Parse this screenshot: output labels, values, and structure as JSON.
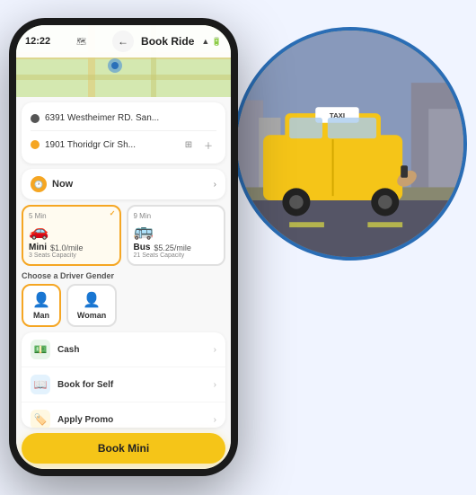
{
  "status_bar": {
    "time": "12:22",
    "signal": "▲▼",
    "wifi": "WiFi",
    "battery": "🔋"
  },
  "header": {
    "back_label": "←",
    "title": "Book Ride"
  },
  "location": {
    "origin": "6391 Westheimer RD. San...",
    "destination": "1901 Thoridgr Cir Sh..."
  },
  "time": {
    "label": "Now",
    "icon": "🕐"
  },
  "ride_options": [
    {
      "name": "Mini",
      "time": "5 Min",
      "icon": "🚗",
      "price": "$1.0/mile",
      "capacity": "3 Seats Capacity",
      "selected": true
    },
    {
      "name": "Bus",
      "time": "9 Min",
      "icon": "🚌",
      "price": "$5.25/mile",
      "capacity": "21 Seats Capacity",
      "selected": false
    }
  ],
  "gender_section": {
    "label": "Choose a Driver Gender"
  },
  "gender_options": [
    {
      "label": "Man",
      "icon": "👤",
      "selected": true
    },
    {
      "label": "Woman",
      "icon": "👤",
      "selected": false
    }
  ],
  "menu_items": [
    {
      "id": "cash",
      "icon": "💵",
      "icon_class": "cash",
      "label": "Cash"
    },
    {
      "id": "self",
      "icon": "📖",
      "icon_class": "self",
      "label": "Book for Self"
    },
    {
      "id": "promo",
      "icon": "🏷️",
      "icon_class": "promo",
      "label": "Apply Promo"
    }
  ],
  "book_button": {
    "label": "Book Mini"
  },
  "taxi_image": {
    "alt": "Yellow taxi cab on street"
  }
}
